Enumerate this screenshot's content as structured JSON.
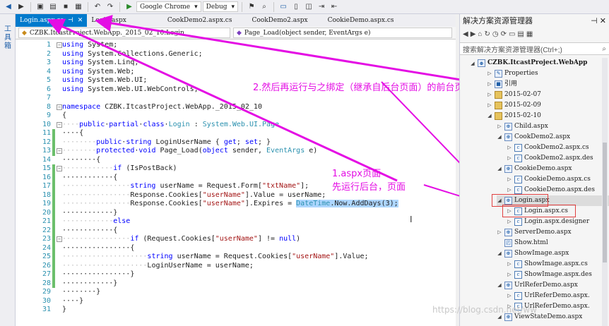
{
  "toolbar": {
    "browser_label": "Google Chrome",
    "config_label": "Debug"
  },
  "left_strip": {
    "label": "工具箱"
  },
  "editor_tabs": [
    {
      "label": "Login.aspx.cs",
      "active": true
    },
    {
      "label": "Login.aspx",
      "active": false
    },
    {
      "label": "CookDemo2.aspx.cs",
      "active": false
    },
    {
      "label": "CookDemo2.aspx",
      "active": false
    },
    {
      "label": "CookieDemo.aspx.cs",
      "active": false
    }
  ],
  "nav": {
    "class_combo": "CZBK.ItcastProject.WebApp._2015_02_10.Login",
    "member_combo": "Page_Load(object sender, EventArgs e)"
  },
  "code_lines": [
    "1",
    "2",
    "3",
    "4",
    "5",
    "6",
    "7",
    "8",
    "9",
    "10",
    "11",
    "12",
    "13",
    "14",
    "15",
    "16",
    "17",
    "18",
    "19",
    "20",
    "21",
    "22",
    "23",
    "24",
    "25",
    "26",
    "27",
    "28",
    "29",
    "30",
    "31"
  ],
  "code": {
    "l1_kw": "using",
    "l1_rest": " System;",
    "l2_kw": "using",
    "l2_rest": " System.Collections.Generic;",
    "l3_kw": "using",
    "l3_rest": " System.Linq;",
    "l4_kw": "using",
    "l4_rest": " System.Web;",
    "l5_kw": "using",
    "l5_rest": " System.Web.UI;",
    "l6_kw": "using",
    "l6_rest": " System.Web.UI.WebControls;",
    "l8_kw": "namespace",
    "l8_rest": " CZBK.ItcastProject.WebApp._2015_02_10",
    "l9": "{",
    "l10_ind": "····",
    "l10_kw1": "public",
    "l10_kw2": "partial",
    "l10_kw3": "class",
    "l10_ty": "Login",
    "l10_sep": " : ",
    "l10_ty2": "System.Web.UI.Page",
    "l11": "····{",
    "l12_ind": "········",
    "l12_kw1": "public",
    "l12_kw2": "string",
    "l12_rest1": " LoginUserName { ",
    "l12_kw3": "get",
    "l12_rest2": "; ",
    "l12_kw4": "set",
    "l12_rest3": "; }",
    "l13_ind": "········",
    "l13_kw1": "protected",
    "l13_kw2": "void",
    "l13_rest1": " Page_Load(",
    "l13_kw3": "object",
    "l13_rest2": " sender, ",
    "l13_ty": "EventArgs",
    "l13_rest3": " e)",
    "l14": "········{",
    "l15_ind": "············",
    "l15_kw": "if",
    "l15_rest": " (IsPostBack)",
    "l16": "············{",
    "l17_ind": "················",
    "l17_kw": "string",
    "l17_rest1": " userName = Request.Form[",
    "l17_st": "\"txtName\"",
    "l17_rest2": "];",
    "l18_ind": "················",
    "l18_rest1": "Response.Cookies[",
    "l18_st": "\"userName\"",
    "l18_rest2": "].Value = userName;",
    "l19_ind": "················",
    "l19_rest1": "Response.Cookies[",
    "l19_st": "\"userName\"",
    "l19_rest2": "].Expires = ",
    "l19_ty": "DateTime",
    "l19_rest3": ".Now.AddDays(3);",
    "l20": "············}",
    "l21_ind": "············",
    "l21_kw": "else",
    "l22": "············{",
    "l23_ind": "················",
    "l23_kw": "if",
    "l23_rest1": " (Request.Cookies[",
    "l23_st": "\"userName\"",
    "l23_rest2": "] != ",
    "l23_kw2": "null",
    "l23_rest3": ")",
    "l24": "················{",
    "l25_ind": "····················",
    "l25_kw": "string",
    "l25_rest1": " userName = Request.Cookies[",
    "l25_st": "\"userName\"",
    "l25_rest2": "].Value;",
    "l26_ind": "····················",
    "l26_rest": "LoginUserName = userName;",
    "l27": "················}",
    "l28": "············}",
    "l29": "········}",
    "l30": "····}",
    "l31": "}"
  },
  "annotations": {
    "a1_line1": "1.aspx页面",
    "a1_line2": "先运行后台，页面",
    "a2": "2.然后再运行与之绑定（继承自后台页面）的前台页面，"
  },
  "solution": {
    "title": "解决方案资源管理器",
    "search_placeholder": "搜索解决方案资源管理器(Ctrl+;)",
    "nodes": [
      {
        "label": "CZBK.ItcastProject.WebApp"
      },
      {
        "label": "Properties"
      },
      {
        "label": "引用"
      },
      {
        "label": "2015-02-07"
      },
      {
        "label": "2015-02-09"
      },
      {
        "label": "2015-02-10"
      },
      {
        "label": "Child.aspx"
      },
      {
        "label": "CookDemo2.aspx"
      },
      {
        "label": "CookDemo2.aspx.cs"
      },
      {
        "label": "CookDemo2.aspx.des"
      },
      {
        "label": "CookieDemo.aspx"
      },
      {
        "label": "CookieDemo.aspx.cs"
      },
      {
        "label": "CookieDemo.aspx.des"
      },
      {
        "label": "Login.aspx"
      },
      {
        "label": "Login.aspx.cs"
      },
      {
        "label": "Login.aspx.designer"
      },
      {
        "label": "ServerDemo.aspx"
      },
      {
        "label": "Show.html"
      },
      {
        "label": "ShowImage.aspx"
      },
      {
        "label": "ShowImage.aspx.cs"
      },
      {
        "label": "ShowImage.aspx.des"
      },
      {
        "label": "UrlReferDemo.aspx"
      },
      {
        "label": "UrlReferDemo.aspx."
      },
      {
        "label": "UrlReferDemo.aspx."
      },
      {
        "label": "ViewStateDemo.aspx"
      }
    ]
  },
  "watermark": "https://blog.csdn.net/ww",
  "colors": {
    "accent": "#007acc",
    "annotation": "#e40de4",
    "highlight_box": "#e04040"
  }
}
